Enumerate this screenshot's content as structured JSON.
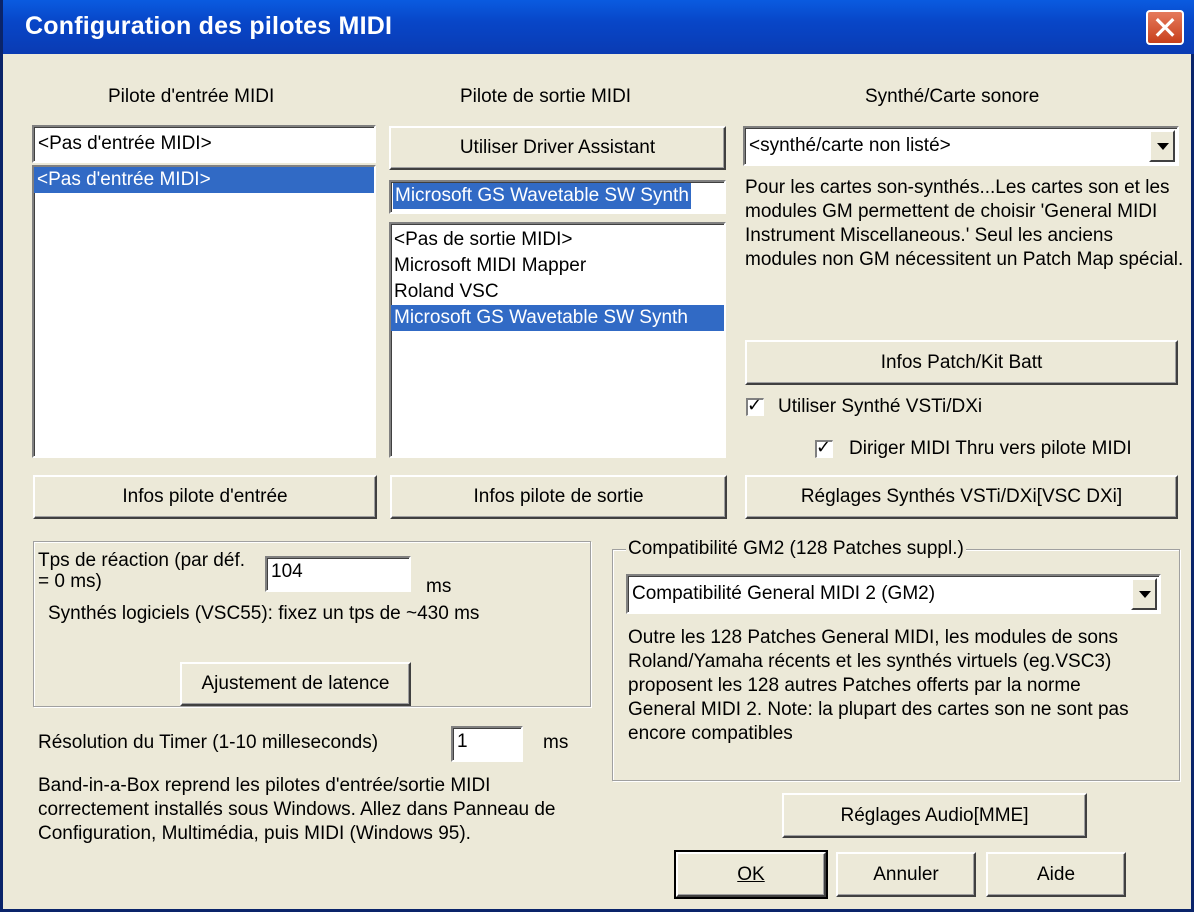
{
  "window": {
    "title": "Configuration des pilotes MIDI"
  },
  "input_driver": {
    "heading": "Pilote d'entrée MIDI",
    "current": "<Pas d'entrée MIDI>",
    "list": [
      "<Pas d'entrée MIDI>"
    ],
    "info_button": "Infos pilote d'entrée"
  },
  "output_driver": {
    "heading": "Pilote de sortie MIDI",
    "assistant_button": "Utiliser Driver Assistant",
    "current": "Microsoft GS Wavetable SW Synth",
    "list": [
      "<Pas de sortie MIDI>",
      "Microsoft MIDI Mapper",
      "Roland VSC",
      "Microsoft GS Wavetable SW Synth"
    ],
    "info_button": "Infos pilote de sortie"
  },
  "synth": {
    "heading": "Synthé/Carte sonore",
    "selected": "<synthé/carte non listé>",
    "description": "Pour les cartes son-synthés...Les cartes son et les modules GM permettent de choisir 'General MIDI  Instrument Miscellaneous.' Seul les anciens modules non GM nécessitent un Patch Map spécial.",
    "patch_button": "Infos Patch/Kit Batt",
    "use_vsti_label": "Utiliser Synthé VSTi/DXi",
    "use_vsti_checked": true,
    "midi_thru_label": "Diriger MIDI Thru vers pilote MIDI",
    "midi_thru_checked": true,
    "vsti_settings_button": "Réglages Synthés VSTi/DXi[VSC DXi]"
  },
  "latency": {
    "label": "Tps de réaction (par déf. = 0 ms)",
    "value": "104",
    "unit": "ms",
    "hint": "Synthés logiciels (VSC55): fixez un tps de ~430 ms",
    "adjust_button": "Ajustement de latence"
  },
  "timer": {
    "label": "Résolution du Timer (1-10 milleseconds)",
    "value": "1",
    "unit": "ms"
  },
  "footer_note": "Band-in-a-Box reprend les pilotes d'entrée/sortie MIDI correctement installés sous Windows. Allez dans Panneau de Configuration, Multimédia, puis MIDI (Windows 95).",
  "gm2": {
    "group_label": "Compatibilité GM2 (128 Patches suppl.)",
    "selected": "Compatibilité General MIDI 2 (GM2)",
    "description": "Outre les 128 Patches General MIDI, les modules de sons Roland/Yamaha récents et les synthés virtuels (eg.VSC3) proposent les 128 autres Patches offerts par la norme General MIDI 2. Note: la plupart des cartes son ne sont pas encore compatibles"
  },
  "audio_button": "Réglages Audio[MME]",
  "ok_button": "OK",
  "cancel_button": "Annuler",
  "help_button": "Aide"
}
